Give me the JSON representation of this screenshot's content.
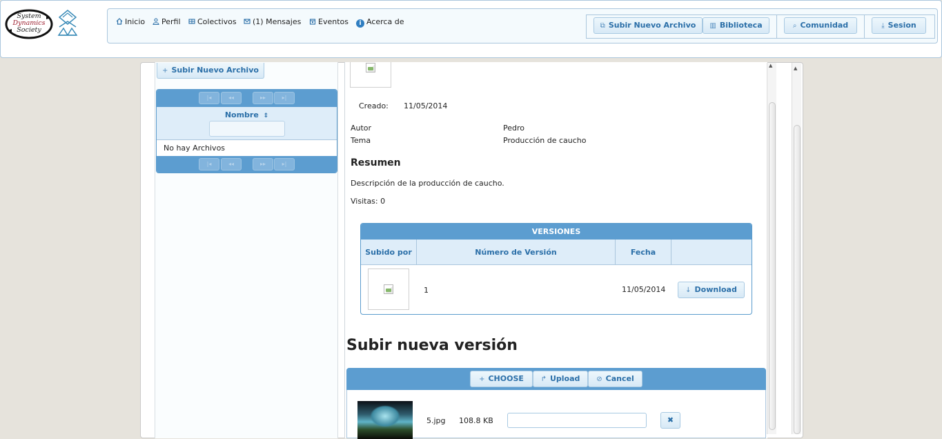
{
  "header": {
    "logo_lines": [
      "System",
      "Dynamics",
      "Society"
    ],
    "nav": [
      {
        "label": "Inicio",
        "icon": "home-icon"
      },
      {
        "label": "Perfil",
        "icon": "person-icon"
      },
      {
        "label": "Colectivos",
        "icon": "group-icon"
      },
      {
        "label": "(1) Mensajes",
        "icon": "mail-icon"
      },
      {
        "label": "Eventos",
        "icon": "calendar-icon"
      },
      {
        "label": "Acerca de",
        "icon": "info-icon"
      }
    ],
    "actions": {
      "upload": "Subir Nuevo Archivo",
      "library": "Biblioteca",
      "community": "Comunidad",
      "session": "Sesion"
    }
  },
  "sidebar": {
    "upload_button": "Subir Nuevo Archivo",
    "table": {
      "column_header": "Nombre",
      "empty_message": "No hay Archivos",
      "paginator": [
        "|◂",
        "◂◂",
        "▸▸",
        "▸|"
      ]
    }
  },
  "file": {
    "created_label": "Creado:",
    "created_value": "11/05/2014",
    "author_label": "Autor",
    "author_value": "Pedro",
    "topic_label": "Tema",
    "topic_value": "Producción de caucho",
    "summary_heading": "Resumen",
    "summary_text": "Descripción de la producción de caucho.",
    "visits": "Visitas: 0"
  },
  "versions": {
    "title": "VERSIONES",
    "headers": [
      "Subido por",
      "Número de Versión",
      "Fecha"
    ],
    "rows": [
      {
        "version": "1",
        "date": "11/05/2014",
        "action": "Download"
      }
    ]
  },
  "upload": {
    "heading": "Subir nueva versión",
    "choose": "CHOOSE",
    "upload": "Upload",
    "cancel": "Cancel",
    "file": {
      "name": "5.jpg",
      "size": "108.8 KB"
    }
  }
}
